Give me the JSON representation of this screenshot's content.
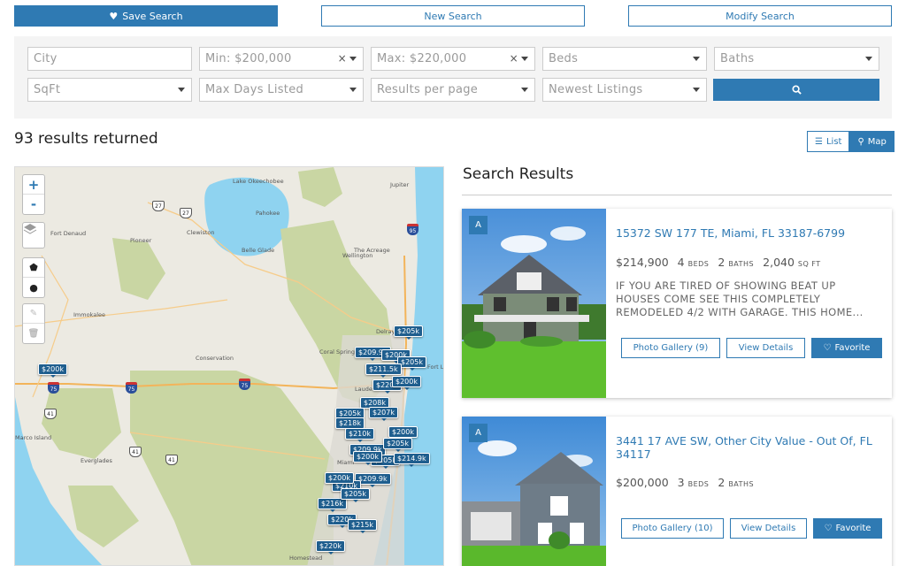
{
  "top_buttons": {
    "save_search": "Save Search",
    "new_search": "New Search",
    "modify_search": "Modify Search"
  },
  "filters": {
    "city_placeholder": "City",
    "min_price": "Min: $200,000",
    "max_price": "Max: $220,000",
    "beds": "Beds",
    "baths": "Baths",
    "sqft": "SqFt",
    "max_days_listed": "Max Days Listed",
    "results_per_page": "Results per page",
    "sort": "Newest Listings",
    "clear_symbol": "×"
  },
  "results": {
    "count_text": "93 results returned",
    "view_list": "List",
    "view_map": "Map",
    "section_title": "Search Results"
  },
  "map": {
    "zoom_in": "+",
    "zoom_out": "-",
    "place_labels": [
      "Lake Okeechobee",
      "Pahokee",
      "Clewiston",
      "Fort Denaud",
      "Pioneer",
      "Belle Glade",
      "The Acreage",
      "Wellington",
      "Jupiter",
      "Immokalee",
      "Delray Beach",
      "Coral Springs",
      "Conservation",
      "Lauderdale",
      "Everglades",
      "Homestead",
      "Miami",
      "Marco Island",
      "Fort Lauderdale"
    ],
    "route_shields": [
      "27",
      "27",
      "95",
      "75",
      "75",
      "75",
      "41",
      "41",
      "41"
    ],
    "pins": [
      "$200k",
      "$205k",
      "$209.9k",
      "$200k",
      "$205k",
      "$211.5k",
      "$220k",
      "$200k",
      "$208k",
      "$207k",
      "$205k",
      "$218k",
      "$210k",
      "$200k",
      "$209.9k",
      "$205k",
      "$205k",
      "$214.9k",
      "$200k",
      "$209.9k",
      "$216k",
      "$220k",
      "$215k",
      "$220k",
      "$210k",
      "$200k",
      "$205k"
    ]
  },
  "listings": [
    {
      "badge": "A",
      "address": "15372 SW 177 TE, Miami, FL 33187-6799",
      "price": "$214,900",
      "beds": "4",
      "beds_unit": "BEDS",
      "baths": "2",
      "baths_unit": "BATHS",
      "sqft": "2,040",
      "sqft_unit": "SQ FT",
      "description": "IF YOU ARE TIRED OF SHOWING BEAT UP HOUSES COME SEE THIS COMPLETELY REMODELED 4/2 WITH GARAGE. THIS HOME...",
      "photo_gallery": "Photo Gallery (9)",
      "view_details": "View Details",
      "favorite": "Favorite"
    },
    {
      "badge": "A",
      "address": "3441 17 AVE SW, Other City Value - Out Of, FL 34117",
      "price": "$200,000",
      "beds": "3",
      "beds_unit": "BEDS",
      "baths": "2",
      "baths_unit": "BATHS",
      "photo_gallery": "Photo Gallery (10)",
      "view_details": "View Details",
      "favorite": "Favorite"
    }
  ],
  "colors": {
    "accent": "#2f7ab3",
    "map_land": "#eceae2",
    "map_water": "#8fd3f0",
    "map_park": "#c9d6a3",
    "pin": "#1f5e8e"
  }
}
